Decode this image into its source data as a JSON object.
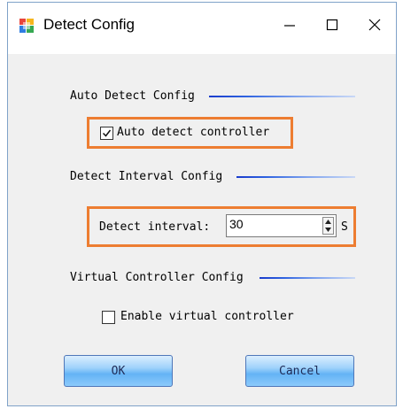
{
  "window": {
    "title": "Detect Config"
  },
  "titlebar": {
    "minimize_icon": "minimize-icon",
    "maximize_icon": "maximize-icon",
    "close_icon": "close-icon"
  },
  "auto_detect": {
    "group_label": "Auto Detect Config",
    "checkbox_label": "Auto detect controller",
    "checked": true
  },
  "detect_interval": {
    "group_label": "Detect Interval Config",
    "field_label": "Detect interval:",
    "value": "30",
    "unit": "S"
  },
  "virtual_controller": {
    "group_label": "Virtual Controller Config",
    "checkbox_label": "Enable virtual controller",
    "checked": false
  },
  "buttons": {
    "ok": "OK",
    "cancel": "Cancel"
  },
  "colors": {
    "highlight": "#ed7d31",
    "separator": "#1a3ccc",
    "button": "#64b3f5",
    "client_bg": "#f0f0f0"
  }
}
